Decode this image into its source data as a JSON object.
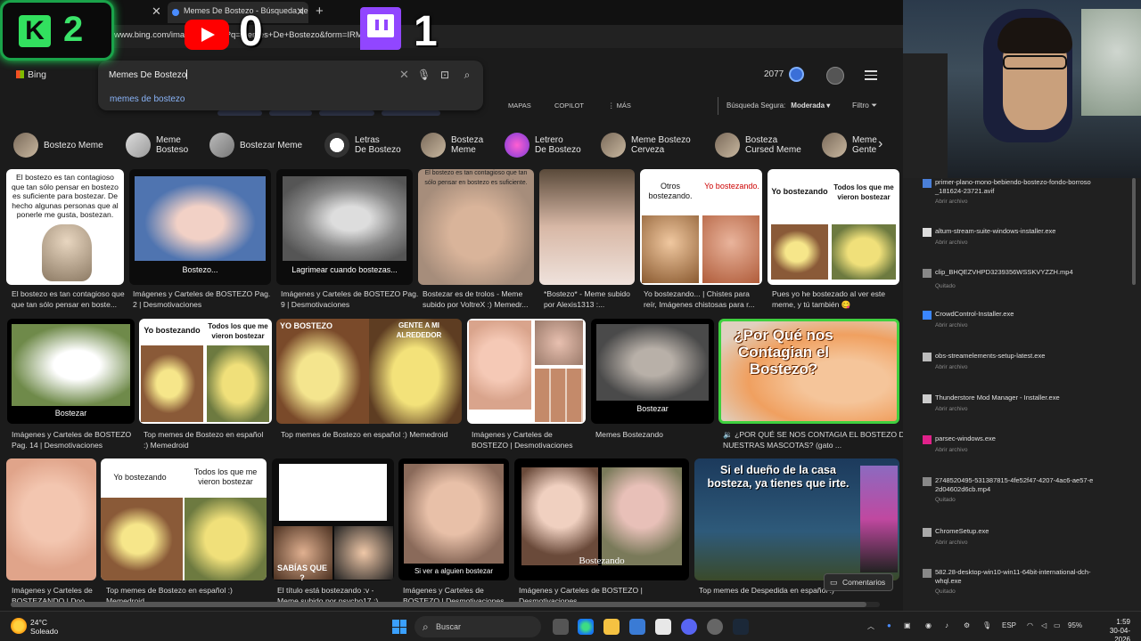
{
  "browser": {
    "active_tab_title": "Memes De Bostezo - Búsqueda de Im",
    "url": "www.bing.com/images/search?q=Memes+De+Bostezo&form=IRMH"
  },
  "overlay": {
    "kick_count": "2",
    "youtube_count": "0",
    "twitch_count": "1",
    "kick_logo": "K"
  },
  "bing": {
    "logo": "Bing",
    "search_value": "Memes De Bostezo",
    "suggestion": "memes de bostezo",
    "points": "2077",
    "nav": [
      "MAPAS",
      "COPILOT",
      "⋮ MÁS"
    ],
    "safe_label": "Búsqueda Segura:",
    "safe_value": "Moderada ▾",
    "filter": "Filtro"
  },
  "chips": [
    {
      "line1": "Bostezo Meme",
      "line2": ""
    },
    {
      "line1": "Meme",
      "line2": "Bosteso"
    },
    {
      "line1": "Bostezar Meme",
      "line2": ""
    },
    {
      "line1": "Letras",
      "line2": "De Bostezo"
    },
    {
      "line1": "Bosteza",
      "line2": "Meme"
    },
    {
      "line1": "Letrero",
      "line2": "De Bostezo"
    },
    {
      "line1": "Meme Bostezo",
      "line2": "Cerveza"
    },
    {
      "line1": "Bosteza",
      "line2": "Cursed Meme"
    },
    {
      "line1": "Meme",
      "line2": "Gente"
    }
  ],
  "results": {
    "row1": [
      {
        "img_text": "El bostezo es tan contagioso que tan sólo pensar en bostezo es suficiente para bostezar. De hecho algunas personas que al ponerle me gusta, bostezan.",
        "cap1": "El bostezo es tan contagioso que",
        "cap2": "que tan sólo pensar en boste..."
      },
      {
        "img_text": "Bostezo...",
        "cap1": "Imágenes y Carteles de BOSTEZO Pag.",
        "cap2": "2 | Desmotivaciones"
      },
      {
        "img_text": "Lagrimear cuando bostezas...",
        "cap1": "Imágenes y Carteles de BOSTEZO Pag.",
        "cap2": "9 | Desmotivaciones"
      },
      {
        "img_text": "El bostezo es tan contagioso que tan sólo pensar en bostezo es suficiente.",
        "cap1": "Bostezar es de trolos - Meme",
        "cap2": "subido por VoltreX :) Memedr..."
      },
      {
        "img_text": "",
        "cap1": "*Bostezo* - Meme subido",
        "cap2": "por Alexis1313 :..."
      },
      {
        "img_text_l": "Otros bostezando.",
        "img_text_r": "Yo bostezando.",
        "cap1": "Yo bostezando... | Chistes para",
        "cap2": "reír, Imágenes chistosas para r..."
      },
      {
        "img_text_l": "Yo bostezando",
        "img_text_r": "Todos los que me vieron bostezar",
        "cap1": "Pues yo he bostezado al ver este",
        "cap2": "meme, y tú también 😋"
      }
    ],
    "row2": [
      {
        "img_text": "Bostezar",
        "cap1": "Imágenes y Carteles de BOSTEZO",
        "cap2": "Pag. 14 | Desmotivaciones"
      },
      {
        "img_text_l": "Yo bostezando",
        "img_text_r": "Todos los que me vieron bostezar",
        "cap1": "Top memes de Bostezo en español",
        "cap2": ":) Memedroid"
      },
      {
        "img_text_l": "YO BOSTEZO",
        "img_text_r": "GENTE A MI ALREDEDOR",
        "cap1": "Top memes de Bostezo en español :) Memedroid",
        "cap2": ""
      },
      {
        "img_text": "",
        "cap1": "Imágenes y Carteles de",
        "cap2": "BOSTEZO | Desmotivaciones"
      },
      {
        "img_text": "Bostezar",
        "cap1": "Memes Bostezando",
        "cap2": ""
      },
      {
        "img_text": "¿Por Qué nos Contagian el Bostezo?",
        "cap1": "🔉 ¿POR QUÉ SE NOS CONTAGIA EL BOSTEZO DE",
        "cap2": "NUESTRAS MASCOTAS? (gato ..."
      }
    ],
    "row3": [
      {
        "img_text": "",
        "cap1": "Imágenes y Carteles de",
        "cap2": "BOSTEZANDO | Doo..."
      },
      {
        "img_text_l": "Yo bostezando",
        "img_text_r": "Todos los que me vieron bostezar",
        "cap1": "Top memes de Bostezo en español :)",
        "cap2": "Memedroid"
      },
      {
        "img_text": "SABÍAS QUE ?",
        "cap1": "El título está bostezando :v -",
        "cap2": "Meme subido por psycho17 :)"
      },
      {
        "img_text": "Si ver a alguien bostezar",
        "cap1": "Imágenes y Carteles de",
        "cap2": "BOSTEZO | Desmotivaciones"
      },
      {
        "img_text": "Bostezando",
        "cap1": "Imágenes y Carteles de BOSTEZO |",
        "cap2": "Desmotivaciones"
      },
      {
        "img_text": "Si el dueño de la casa bosteza, ya tienes que irte.",
        "cap1": "Top memes de Despedida en español :)",
        "cap2": ""
      }
    ]
  },
  "comments_button": "Comentarios",
  "downloads": [
    {
      "name": "primer-plano-mono-bebiendo-bostezo-fondo-borroso_181624-23721.avif",
      "sub": "Abrir archivo",
      "color": "#4a7fd8"
    },
    {
      "name": "altum-stream-suite-windows-installer.exe",
      "sub": "Abrir archivo",
      "color": "#dddddd"
    },
    {
      "name": "clip_BHQEZVHPD3239356WSSKVYZZH.mp4",
      "sub": "Quitado",
      "color": "#888888"
    },
    {
      "name": "CrowdControl-Installer.exe",
      "sub": "Abrir archivo",
      "color": "#3a86ff"
    },
    {
      "name": "obs-streamelements-setup-latest.exe",
      "sub": "Abrir archivo",
      "color": "#bbbbbb"
    },
    {
      "name": "Thunderstore Mod Manager - Installer.exe",
      "sub": "Abrir archivo",
      "color": "#cccccc"
    },
    {
      "name": "parsec-windows.exe",
      "sub": "Abrir archivo",
      "color": "#e0218a"
    },
    {
      "name": "2748520495-531387815-4fe52f47-4207-4ac6-ae57-e2d04602d6cb.mp4",
      "sub": "Quitado",
      "color": "#888888"
    },
    {
      "name": "ChromeSetup.exe",
      "sub": "Abrir archivo",
      "color": "#aaaaaa"
    },
    {
      "name": "582.28-desktop-win10-win11-64bit-international-dch-whql.exe",
      "sub": "Quitado",
      "color": "#888888"
    }
  ],
  "taskbar": {
    "temp": "24°C",
    "weather": "Soleado",
    "search": "Buscar",
    "lang": "ESP",
    "battery": "95%",
    "time": "1:59",
    "date": "30-04-2026"
  }
}
